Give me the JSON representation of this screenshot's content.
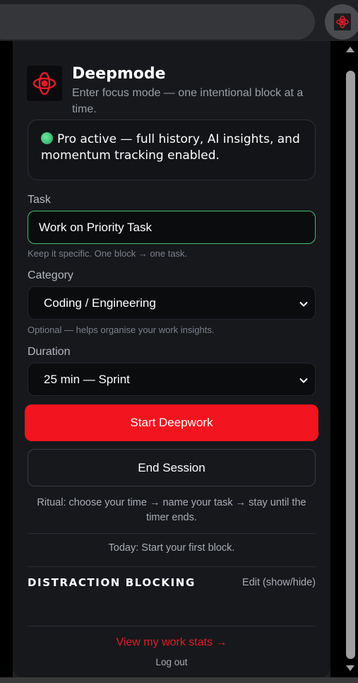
{
  "app": {
    "name": "Deepmode",
    "tagline": "Enter focus mode — one intentional block at a time."
  },
  "pro_banner": {
    "text": "Pro active — full history, AI insights, and momentum tracking enabled.",
    "status_color": "#3fbf6f"
  },
  "task": {
    "label": "Task",
    "value": "Work on Priority Task",
    "hint": "Keep it specific. One block → one task."
  },
  "category": {
    "label": "Category",
    "selected": "Coding / Engineering",
    "hint": "Optional — helps organise your work insights."
  },
  "duration": {
    "label": "Duration",
    "selected": "25 min — Sprint"
  },
  "buttons": {
    "start": "Start Deepwork",
    "end": "End Session"
  },
  "ritual_text": "Ritual: choose your time → name your task → stay until the timer ends.",
  "today_text": "Today: Start your first block.",
  "distraction": {
    "title": "DISTRACTION BLOCKING",
    "edit": "Edit (show/hide)"
  },
  "footer": {
    "stats_link": "View my work stats →",
    "logout": "Log out"
  },
  "colors": {
    "accent": "#f2141e",
    "background": "#17181c",
    "focus_border": "#3fbf6f"
  }
}
